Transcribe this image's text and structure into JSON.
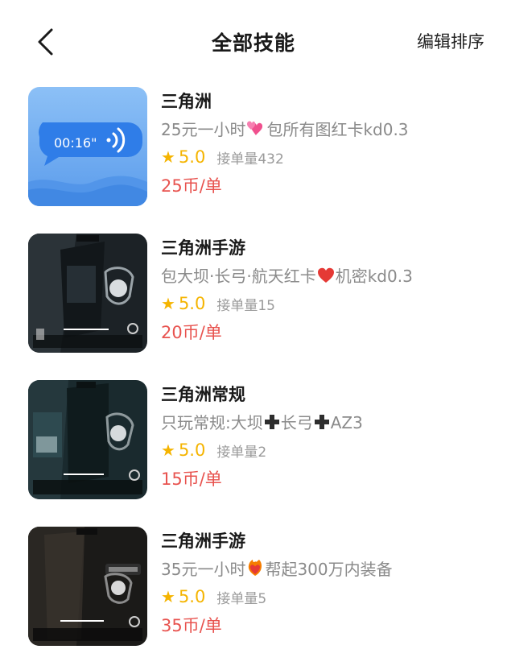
{
  "header": {
    "title": "全部技能",
    "edit_sort_label": "编辑排序",
    "back_icon": "chevron-left-icon"
  },
  "colors": {
    "price": "#e8534f",
    "star": "#f5b400",
    "voice_card_bg": "#6aa8f0",
    "voice_bubble": "#2f7de8"
  },
  "skills": [
    {
      "name": "三角洲",
      "desc_before": "25元一小时",
      "desc_emoji": "two-hearts",
      "desc_after": "包所有图红卡kd0.3",
      "rating": "5.0",
      "orders_label": "接单量",
      "orders": "432",
      "price": "25币/单",
      "thumb": "voice-card",
      "voice_duration": "00:16\""
    },
    {
      "name": "三角洲手游",
      "desc_before": "包大坝·长弓·航天红卡",
      "desc_emoji": "red-heart",
      "desc_after": "机密kd0.3",
      "rating": "5.0",
      "orders_label": "接单量",
      "orders": "15",
      "price": "20币/单",
      "thumb": "game-screenshot"
    },
    {
      "name": "三角洲常规",
      "desc_before": "只玩常规:大坝",
      "desc_emoji": "plus",
      "desc_mid": "长弓",
      "desc_emoji2": "plus",
      "desc_after": "AZ3",
      "rating": "5.0",
      "orders_label": "接单量",
      "orders": "2",
      "price": "15币/单",
      "thumb": "game-screenshot"
    },
    {
      "name": "三角洲手游",
      "desc_before": "35元一小时",
      "desc_emoji": "heart-on-fire",
      "desc_after": "帮起300万内装备",
      "rating": "5.0",
      "orders_label": "接单量",
      "orders": "5",
      "price": "35币/单",
      "thumb": "game-screenshot"
    }
  ]
}
